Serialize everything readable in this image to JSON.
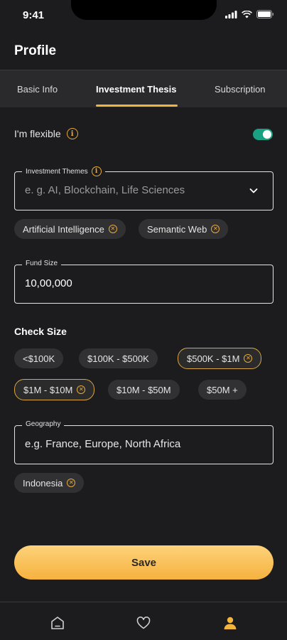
{
  "status": {
    "time": "9:41"
  },
  "header": {
    "title": "Profile"
  },
  "tabs": [
    {
      "label": "Basic Info",
      "active": false
    },
    {
      "label": "Investment Thesis",
      "active": true
    },
    {
      "label": "Subscription",
      "active": false
    }
  ],
  "flexible": {
    "label": "I'm flexible",
    "info_icon": "info-icon",
    "toggle_on": true
  },
  "investment_themes": {
    "legend": "Investment Themes",
    "placeholder": "e. g. AI, Blockchain, Life Sciences",
    "chips": [
      "Artificial Intelligence",
      "Semantic Web"
    ]
  },
  "fund_size": {
    "legend": "Fund Size",
    "value": "10,00,000"
  },
  "check_size": {
    "title": "Check Size",
    "options": [
      {
        "label": "<$100K",
        "selected": false
      },
      {
        "label": "$100K - $500K",
        "selected": false
      },
      {
        "label": "$500K - $1M",
        "selected": true
      },
      {
        "label": "$1M - $10M",
        "selected": true
      },
      {
        "label": "$10M - $50M",
        "selected": false
      },
      {
        "label": "$50M +",
        "selected": false
      }
    ]
  },
  "geography": {
    "legend": "Geography",
    "placeholder": "e.g. France, Europe, North Africa",
    "chips": [
      "Indonesia"
    ]
  },
  "save_label": "Save",
  "bottom_nav": [
    {
      "icon": "home-icon",
      "active": false
    },
    {
      "icon": "heart-icon",
      "active": false
    },
    {
      "icon": "profile-icon",
      "active": true
    }
  ],
  "colors": {
    "accent": "#f3b43c",
    "toggle": "#1aa184",
    "background": "#1c1c1e"
  }
}
